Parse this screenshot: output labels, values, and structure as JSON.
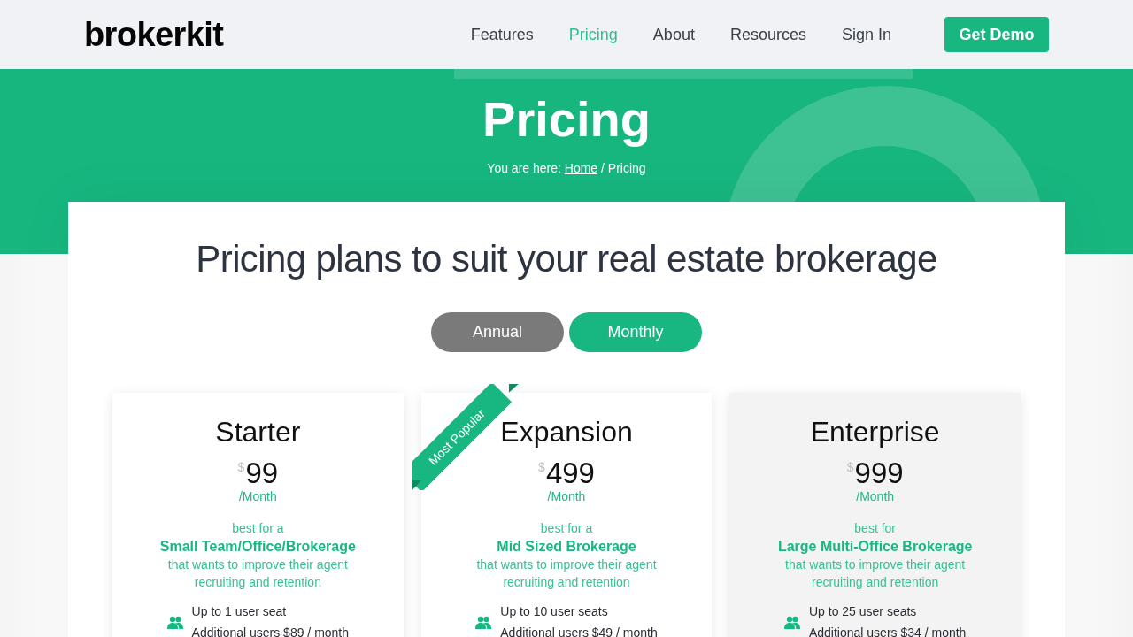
{
  "header": {
    "logo": "brokerkit",
    "nav": [
      {
        "label": "Features",
        "selected": false
      },
      {
        "label": "Pricing",
        "selected": true
      },
      {
        "label": "About",
        "selected": false
      },
      {
        "label": "Resources",
        "selected": false
      },
      {
        "label": "Sign In",
        "selected": false
      }
    ],
    "cta": "Get Demo"
  },
  "hero": {
    "title": "Pricing",
    "breadcrumb": {
      "prefix": "You are here:",
      "link": "Home",
      "separator": "/",
      "current": "Pricing"
    }
  },
  "section": {
    "heading": "Pricing plans to suit your real estate brokerage",
    "billing": [
      {
        "label": "Annual",
        "selected": false
      },
      {
        "label": "Monthly",
        "selected": true
      }
    ]
  },
  "plans": [
    {
      "name": "Starter",
      "currency": "$",
      "price": "99",
      "period": "/Month",
      "best_for": "best for a",
      "audience": "Small Team/Office/Brokerage",
      "description": "that wants to improve their agent recruiting and retention",
      "seats": [
        "Up to 1 user seat",
        "Additional users $89 / month"
      ],
      "highlighted": false
    },
    {
      "name": "Expansion",
      "ribbon": "Most Popular",
      "currency": "$",
      "price": "499",
      "period": "/Month",
      "best_for": "best for a",
      "audience": "Mid Sized Brokerage",
      "description": "that wants to improve their agent recruiting and retention",
      "seats": [
        "Up to 10 user seats",
        "Additional users $49 / month"
      ],
      "highlighted": false
    },
    {
      "name": "Enterprise",
      "currency": "$",
      "price": "999",
      "period": "/Month",
      "best_for": "best for",
      "audience": "Large Multi-Office Brokerage",
      "description": "that wants to improve their agent recruiting and retention",
      "seats": [
        "Up to 25 user seats",
        "Additional users $34 / month"
      ],
      "highlighted": true
    }
  ]
}
